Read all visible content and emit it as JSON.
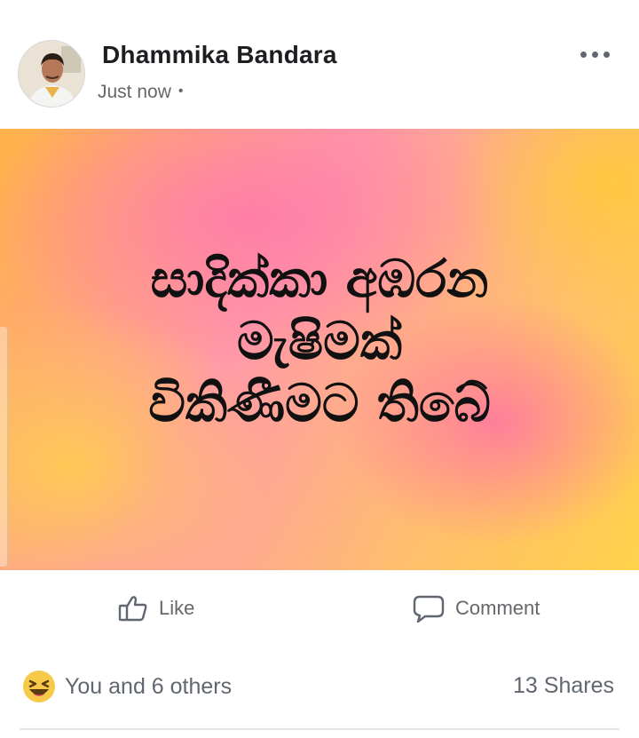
{
  "post": {
    "author": "Dhammika Bandara",
    "time": "Just now",
    "separator": "•",
    "menu_icon": "more-horizontal-icon",
    "avatar_icon": "profile-photo"
  },
  "banner": {
    "lines": [
      "සාදික්කා අඹරන",
      "මැෂිමක්",
      "විකිණීමට තිබේ"
    ],
    "colors": [
      "#ffb347",
      "#ff9aa8",
      "#ffd24a"
    ]
  },
  "actions": {
    "like_label": "Like",
    "like_icon": "thumbs-up-icon",
    "comment_label": "Comment",
    "comment_icon": "speech-bubble-icon"
  },
  "footer": {
    "reactions_text": "You and 6 others",
    "reaction_icon": "laughing-emoji-icon",
    "shares_text": "13 Shares"
  }
}
